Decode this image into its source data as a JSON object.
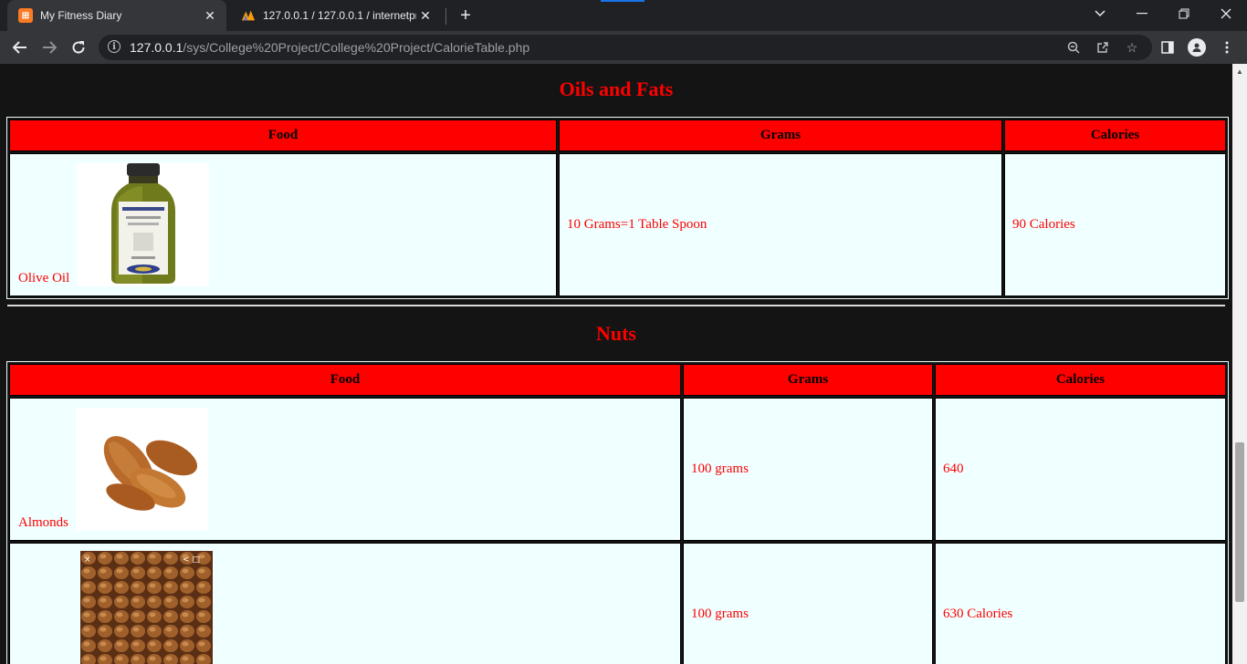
{
  "browser": {
    "tabs": [
      {
        "title": "My Fitness Diary",
        "icon": "xampp-icon",
        "active": true
      },
      {
        "title": "127.0.0.1 / 127.0.0.1 / internetpro",
        "icon": "phpmyadmin-icon",
        "active": false
      }
    ],
    "url_host": "127.0.0.1",
    "url_path": "/sys/College%20Project/College%20Project/CalorieTable.php"
  },
  "page": {
    "colors": {
      "heading": "#ff0000",
      "header_bg": "#ff0000",
      "cell_bg": "#f0ffff",
      "page_bg": "#141414"
    },
    "sections": [
      {
        "heading": "Oils and Fats",
        "headers": [
          "Food",
          "Grams",
          "Calories"
        ],
        "rows": [
          {
            "food": "Olive Oil",
            "grams": "10 Grams=1 Table Spoon",
            "calories": "90 Calories",
            "image": "olive-oil-bottle"
          }
        ]
      },
      {
        "heading": "Nuts",
        "headers": [
          "Food",
          "Grams",
          "Calories"
        ],
        "rows": [
          {
            "food": "Almonds",
            "grams": "100 grams",
            "calories": "640",
            "image": "almonds"
          },
          {
            "food": "",
            "grams": "100 grams",
            "calories": "630 Calories",
            "image": "hazelnuts"
          }
        ]
      }
    ]
  }
}
